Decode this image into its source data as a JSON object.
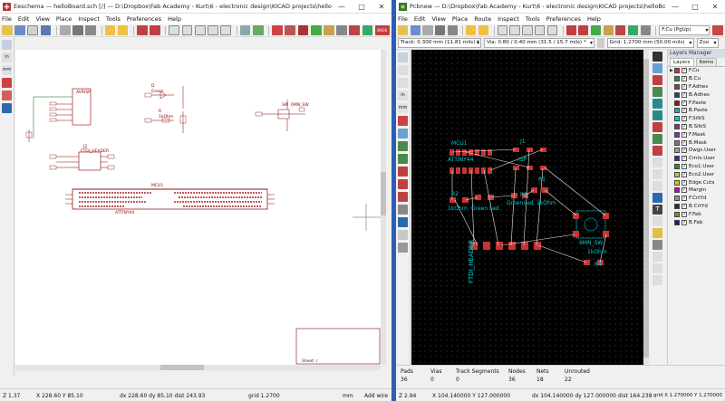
{
  "eeschema": {
    "title": "Eeschema — helloBoard.sch [/] — D:\\Dropbox\\Fab Academy - Kurt\\6 - electronic design\\KICAD projects\\helloBoard",
    "menu": [
      "File",
      "Edit",
      "View",
      "Place",
      "Inspect",
      "Tools",
      "Preferences",
      "Help"
    ],
    "back_label": "BACK",
    "status": {
      "zoom": "Z 1.37",
      "coords": "X 228.60  Y 85.10",
      "delta": "dx 228.60  dy 85.10   dist 243.93",
      "grid": "grid 1.2700",
      "units": "mm",
      "mode": "Add wire"
    },
    "sheet_field": "Sheet: /",
    "schematic": {
      "mcu_ref": "MCU1",
      "mcu_value": "ATTINY44",
      "isp_label": "AVRISP",
      "ftdi_ref": "J2",
      "ftdi_value": "FTDI_HEADER",
      "r_ref": "R",
      "r_value": "1kOhm",
      "led_ref": "D",
      "led_value": "Green",
      "sw_ref": "SW",
      "sw_value": "6MN_SW"
    }
  },
  "pcbnew": {
    "title": "Pcbnew — D:\\Dropbox\\Fab Academy - Kurt\\6 - electronic design\\KICAD projects\\helloBoard\\hello",
    "menu": [
      "File",
      "Edit",
      "View",
      "Place",
      "Route",
      "Inspect",
      "Tools",
      "Preferences",
      "Help"
    ],
    "layer_select": "F.Cu (PgUp)",
    "track_select": "Track: 0.300 mm (11.81 mils) *",
    "via_select": "Via: 0.80 / 0.40 mm (31.5 / 15.7 mils) *",
    "grid_select": "Grid: 1.2700 mm (50.00 mils)",
    "zoom_select": "Zoo",
    "layers_manager": {
      "title": "Layers Manager",
      "tabs": [
        "Layers",
        "Items"
      ],
      "layers": [
        {
          "name": "F.Cu",
          "color": "#c83434"
        },
        {
          "name": "B.Cu",
          "color": "#2e8b57"
        },
        {
          "name": "F.Adhes",
          "color": "#8b3a62"
        },
        {
          "name": "B.Adhes",
          "color": "#3a3a8b"
        },
        {
          "name": "F.Paste",
          "color": "#8b1a1a"
        },
        {
          "name": "B.Paste",
          "color": "#20b2aa"
        },
        {
          "name": "F.SilkS",
          "color": "#00cccc"
        },
        {
          "name": "B.SilkS",
          "color": "#8b2f8b"
        },
        {
          "name": "F.Mask",
          "color": "#8b2fa0"
        },
        {
          "name": "B.Mask",
          "color": "#7a7a7a"
        },
        {
          "name": "Dwgs.User",
          "color": "#a0a0a0"
        },
        {
          "name": "Cmts.User",
          "color": "#3030a0"
        },
        {
          "name": "Eco1.User",
          "color": "#2e8b2e"
        },
        {
          "name": "Eco2.User",
          "color": "#c8c820"
        },
        {
          "name": "Edge.Cuts",
          "color": "#d0d000"
        },
        {
          "name": "Margin",
          "color": "#c800c8"
        },
        {
          "name": "F.CrtYd",
          "color": "#909090"
        },
        {
          "name": "B.CrtYd",
          "color": "#2e2e2e"
        },
        {
          "name": "F.Fab",
          "color": "#8b8b20"
        },
        {
          "name": "B.Fab",
          "color": "#1a1a8b"
        }
      ]
    },
    "board_labels": {
      "mcu": "MCU1",
      "mcu_value": "ATTINY44",
      "j1": "J1",
      "isp": "ISP",
      "r1": "R1",
      "r2": "R2",
      "r3": "R3",
      "r4": "R4",
      "r2_value": "1kOhm",
      "led1": "Led",
      "green1": "Green",
      "green2": "Green",
      "led2": "Led",
      "kohm2": "1kOhm",
      "sw": "6MN_SW",
      "kohm3": "1kOhm",
      "ftdi": "FTDI_HEADER"
    },
    "stats": [
      {
        "label": "Pads",
        "value": "36"
      },
      {
        "label": "Vias",
        "value": "0"
      },
      {
        "label": "Track Segments",
        "value": "0"
      },
      {
        "label": "Nodes",
        "value": "36"
      },
      {
        "label": "Nets",
        "value": "18"
      },
      {
        "label": "Unrouted",
        "value": "22"
      }
    ],
    "status": {
      "zoom": "Z 2.94",
      "coords": "X 104.140000  Y 127.000000",
      "delta": "dx 104.140000  dy 127.000000  dist 164.238",
      "grid": "grid X 1.270000  Y 1.270000"
    }
  }
}
